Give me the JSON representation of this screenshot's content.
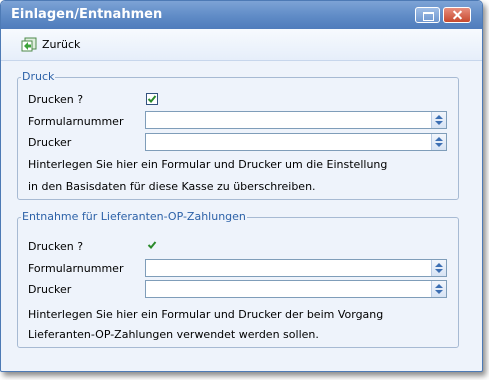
{
  "window": {
    "title": "Einlagen/Entnahmen"
  },
  "toolbar": {
    "back_label": "Zurück"
  },
  "druck": {
    "legend": "Druck",
    "drucken_label": "Drucken ?",
    "drucken_checked": true,
    "formular_label": "Formularnummer",
    "formular_value": "",
    "drucker_label": "Drucker",
    "drucker_value": "",
    "hint_line1": "Hinterlegen Sie hier ein Formular und Drucker um die Einstellung",
    "hint_line2": "in den Basisdaten für diese Kasse zu überschreiben."
  },
  "entnahme": {
    "legend": "Entnahme für Lieferanten-OP-Zahlungen",
    "drucken_label": "Drucken ?",
    "drucken_checked": true,
    "formular_label": "Formularnummer",
    "formular_value": "",
    "drucker_label": "Drucker",
    "drucker_value": "",
    "hint_line1": "Hinterlegen Sie hier ein Formular und Drucker der beim Vorgang",
    "hint_line2": "Lieferanten-OP-Zahlungen verwendet werden sollen."
  },
  "colors": {
    "titlebar": "#5f8bc6",
    "legend_text": "#2d62a8",
    "check": "#2b8a2b"
  }
}
